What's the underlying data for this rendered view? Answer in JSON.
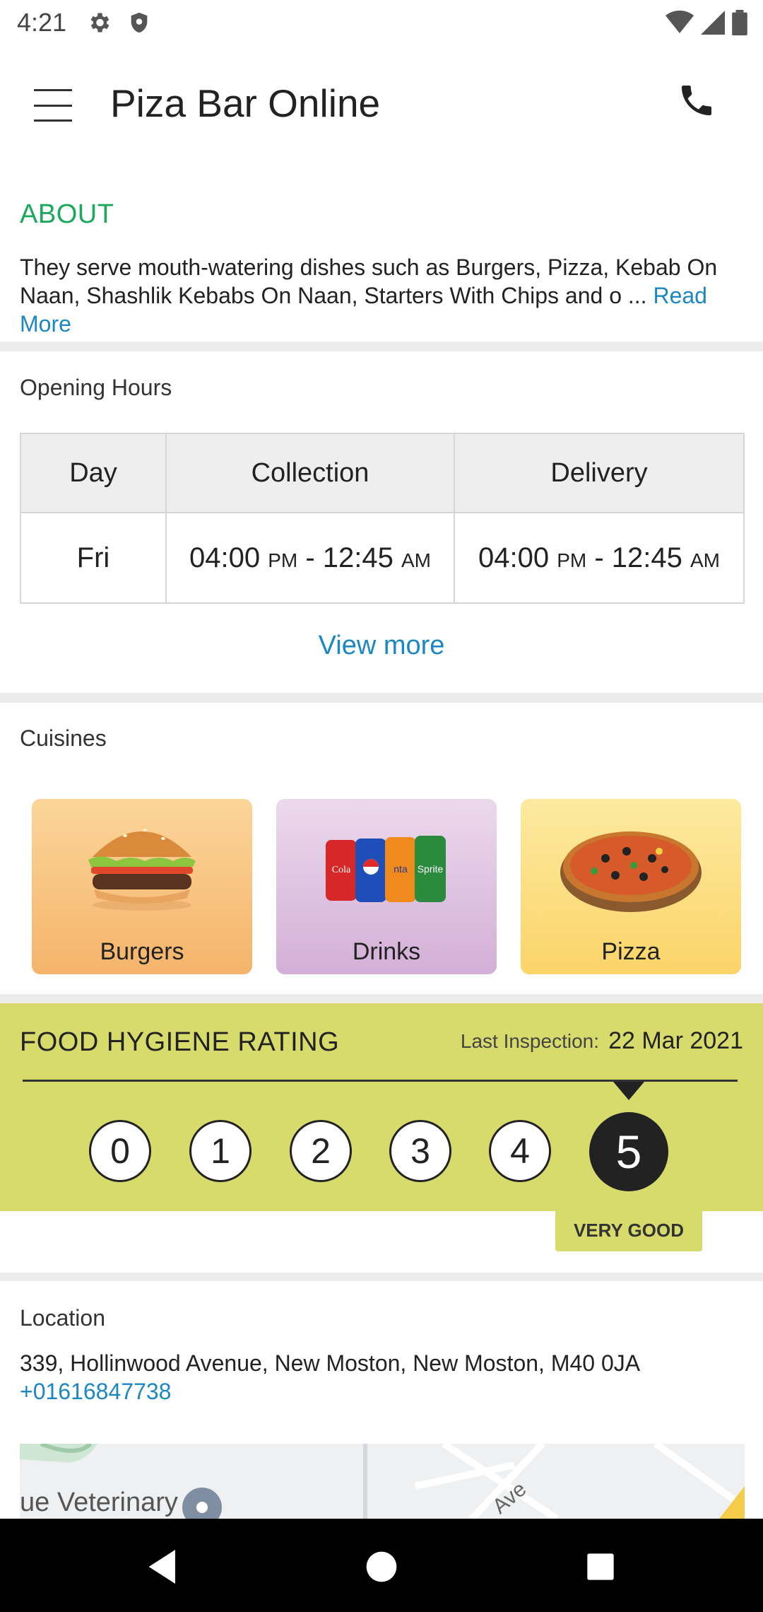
{
  "status_bar": {
    "time": "4:21"
  },
  "app_bar": {
    "title": "Piza Bar Online"
  },
  "about": {
    "heading": "ABOUT",
    "text": "They serve mouth-watering dishes such as Burgers, Pizza, Kebab On Naan, Shashlik Kebabs On Naan, Starters With Chips  and o ...",
    "read_more": "Read More"
  },
  "opening_hours": {
    "title": "Opening Hours",
    "headers": {
      "day": "Day",
      "collection": "Collection",
      "delivery": "Delivery"
    },
    "rows": [
      {
        "day": "Fri",
        "collection": {
          "open": "04:00",
          "open_suffix": "PM",
          "close": "12:45",
          "close_suffix": "AM"
        },
        "delivery": {
          "open": "04:00",
          "open_suffix": "PM",
          "close": "12:45",
          "close_suffix": "AM"
        }
      }
    ],
    "view_more": "View more"
  },
  "cuisines": {
    "title": "Cuisines",
    "items": [
      {
        "label": "Burgers",
        "icon": "burger-icon"
      },
      {
        "label": "Drinks",
        "icon": "soda-cans-icon"
      },
      {
        "label": "Pizza",
        "icon": "pizza-icon"
      }
    ]
  },
  "hygiene": {
    "title": "FOOD HYGIENE RATING",
    "last_inspection_label": "Last Inspection:",
    "last_inspection_date": "22 Mar 2021",
    "ratings": [
      "0",
      "1",
      "2",
      "3",
      "4",
      "5"
    ],
    "selected_rating": 5,
    "verdict": "VERY GOOD",
    "color": "#d7db6b"
  },
  "location": {
    "title": "Location",
    "address": "339, Hollinwood Avenue, New Moston, New Moston, M40 0JA",
    "phone": "+01616847738",
    "map_label": "ue Veterinary",
    "map_street": "Ave"
  },
  "colors": {
    "accent_green": "#1aa85a",
    "link_blue": "#1b87c4"
  }
}
